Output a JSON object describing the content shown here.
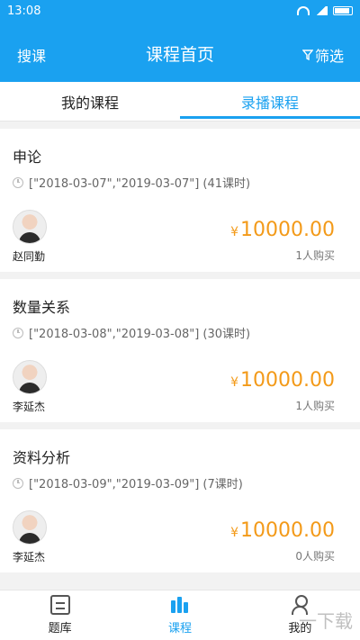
{
  "status": {
    "time": "13:08"
  },
  "header": {
    "search_label": "搜课",
    "title": "课程首页",
    "filter_label": "筛选"
  },
  "tabs": [
    {
      "label": "我的课程",
      "active": false
    },
    {
      "label": "录播课程",
      "active": true
    }
  ],
  "courses": [
    {
      "title": "申论",
      "meta": "[\"2018-03-07\",\"2019-03-07\"] (41课时)",
      "teacher": "赵同勤",
      "currency": "¥",
      "price": "10000.00",
      "buyers": "1人购买"
    },
    {
      "title": "数量关系",
      "meta": "[\"2018-03-08\",\"2019-03-08\"] (30课时)",
      "teacher": "李延杰",
      "currency": "¥",
      "price": "10000.00",
      "buyers": "1人购买"
    },
    {
      "title": "资料分析",
      "meta": "[\"2018-03-09\",\"2019-03-09\"] (7课时)",
      "teacher": "李延杰",
      "currency": "¥",
      "price": "10000.00",
      "buyers": "0人购买"
    }
  ],
  "nav": [
    {
      "label": "题库",
      "icon": "quiz-icon",
      "active": false
    },
    {
      "label": "课程",
      "icon": "course-icon",
      "active": true
    },
    {
      "label": "我的",
      "icon": "user-icon",
      "active": false
    }
  ],
  "watermark": "一下载"
}
